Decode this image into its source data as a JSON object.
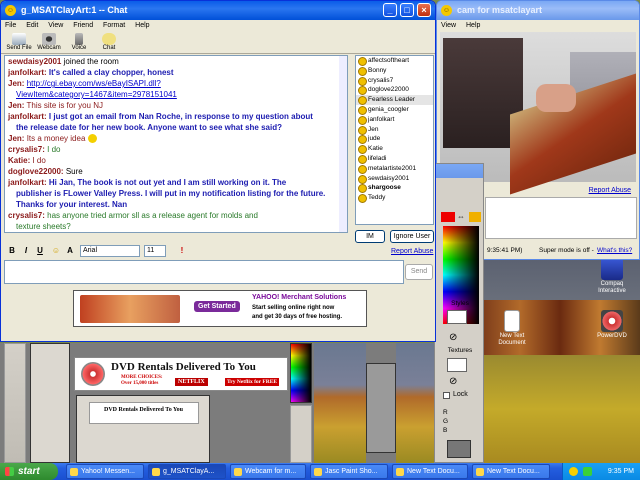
{
  "chat_window": {
    "title": "g_MSATClayArt:1 -- Chat",
    "menu": [
      "File",
      "Edit",
      "View",
      "Friend",
      "Format",
      "Help"
    ],
    "toolbar": [
      "Send File",
      "Webcam",
      "Voice",
      "Chat"
    ],
    "messages": [
      {
        "user": "sewdaisy2001",
        "text": "joined the room"
      },
      {
        "user": "janfolkart:",
        "text": "It's called a clay chopper, honest"
      },
      {
        "user": "Jen:",
        "text": "http://cgi.ebay.com/ws/eBayISAPI.dll?"
      },
      {
        "user": "",
        "text": "ViewItem&category=1467&item=2978151041"
      },
      {
        "user": "Jen:",
        "text": "This site is for you NJ"
      },
      {
        "user": "janfolkart:",
        "text": "I just got an email from Nan Roche, in response to my question about"
      },
      {
        "user": "",
        "text": "the release date for her new book. Anyone want to see what she said?"
      },
      {
        "user": "Jen:",
        "text": "Its a money idea"
      },
      {
        "user": "crysalis7:",
        "text": "I do"
      },
      {
        "user": "Katie:",
        "text": "I do"
      },
      {
        "user": "doglove22000:",
        "text": "Sure"
      },
      {
        "user": "janfolkart:",
        "text": "Hi Jan, The book is not out yet and I am still working on it. The"
      },
      {
        "user": "",
        "text": "publisher is FLower Valley Press. I will put in my notification listing for the future."
      },
      {
        "user": "",
        "text": "Thanks for your interest. Nan"
      },
      {
        "user": "crysalis7:",
        "text": "has anyone tried armor sll as a release agent for molds and"
      },
      {
        "user": "",
        "text": "texture sheets?"
      }
    ],
    "users": [
      "affectsoftheart",
      "Bonny",
      "crysalis7",
      "doglove22000",
      "Fearless Leader",
      "genia_coogler",
      "janfolkart",
      "Jen",
      "jude",
      "Katie",
      "lifeladi",
      "metalartiste2001",
      "sewdaisy2001",
      "shargoose",
      "Teddy"
    ],
    "im_button": "IM",
    "ignore_button": "Ignore User",
    "report_abuse": "Report Abuse",
    "format": {
      "bold": "B",
      "italic": "I",
      "underline": "U",
      "font": "Arial",
      "size": "11"
    },
    "send_button": "Send",
    "ad": {
      "cta": "Get Started",
      "brand": "YAHOO! Merchant Solutions",
      "line1": "Start selling online right now",
      "line2": "and get 30 days of free hosting."
    }
  },
  "webcam_window": {
    "title": "cam for msatclayart",
    "menu": [
      "View",
      "Help"
    ],
    "report_abuse": "Report Abuse",
    "timestamp": "9:35:41 PM)",
    "super_mode": "Super mode is off -",
    "whats_this": "What's this?"
  },
  "paint_palette": {
    "styles_label": "Styles",
    "textures_label": "Textures",
    "lock_label": "Lock",
    "rgb": [
      "R",
      "G",
      "B"
    ]
  },
  "background": {
    "ad_title": "DVD Rentals Delivered To You",
    "ad_sub1": "MORE CHOICES:",
    "ad_sub2": "Over 15,000 titles",
    "ad_brand": "NETFLIX",
    "ad_try": "Try Netflix for FREE"
  },
  "desktop_icons": [
    "Compaq Interactive",
    "New Text Document",
    "PowerDVD"
  ],
  "taskbar": {
    "start": "start",
    "tasks": [
      "Yahoo! Messen...",
      "g_MSATClayA...",
      "Webcam for m...",
      "Jasc Paint Sho...",
      "New Text Docu...",
      "New Text Docu..."
    ],
    "clock": "9:35 PM"
  },
  "colors": {
    "title_blue": "#0a5ce8",
    "taskbar_blue": "#245ee0",
    "start_green": "#3a963a",
    "chat_name": "#8b1a1a",
    "chat_jan": "#1c1cb0"
  }
}
